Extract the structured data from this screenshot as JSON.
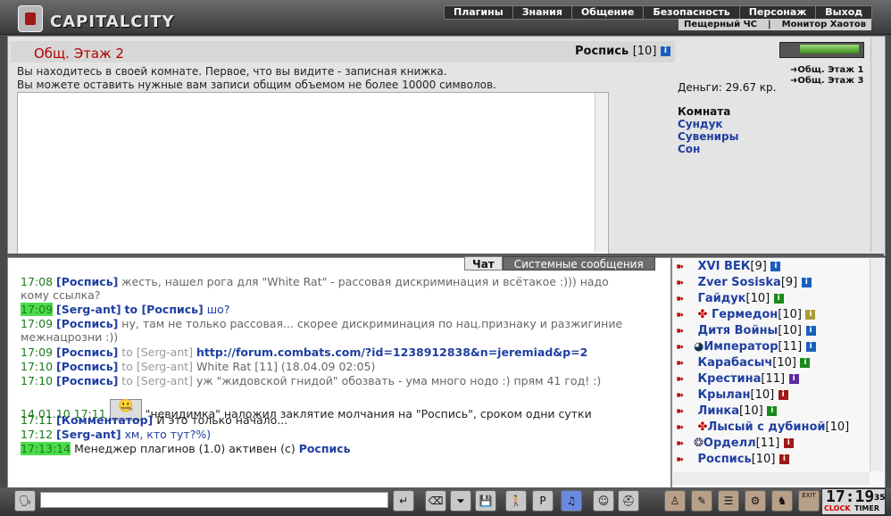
{
  "header": {
    "logo_text": "CAPITALCITY",
    "menu": [
      "Плагины",
      "Знания",
      "Общение",
      "Безопасность",
      "Персонаж",
      "Выход"
    ],
    "submenu": [
      "Пещерный ЧС",
      "|",
      "Монитор Хаотов"
    ]
  },
  "room": {
    "title": "Общ. Этаж 2",
    "user_name": "Роспись",
    "user_level": "[10]",
    "desc_line1": "Вы находитесь в своей комнате. Первое, что вы видите - записная книжка.",
    "desc_line2": "Вы можете оставить нужные вам записи общим объемом не более 10000 символов."
  },
  "side": {
    "nav1": "Общ. Этаж 1",
    "nav2": "Общ. Этаж 3",
    "money": "Деньги: 29.67 кр.",
    "room_heading": "Комната",
    "room_links": [
      "Сундук",
      "Сувениры",
      "Сон"
    ]
  },
  "chat_tabs": {
    "chat": "Чат",
    "system": "Системные сообщения"
  },
  "chat": [
    {
      "time": "17:08",
      "nick": "[Роспись]",
      "text": "жесть, нашел рога для \"White Rat\" - рассовая дискриминация и всётакое :))) надо"
    },
    {
      "cont": "кому ссылка?"
    },
    {
      "time": "17:09",
      "nick": "[Serg-ant]",
      "to": "to [Роспись]",
      "text": "шо?"
    },
    {
      "time": "17:09",
      "nick": "[Роспись]",
      "text": "ну, там не только рассовая... скорее дискриминация по нац.признаку и разжигиние"
    },
    {
      "cont": "межнацрозни :))"
    },
    {
      "time": "17:09",
      "nick": "[Роспись]",
      "to": "to [Serg-ant]",
      "url": "http://forum.combats.com/?id=1238912838&n=jeremiad&p=2"
    },
    {
      "time": "17:10",
      "nick": "[Роспись]",
      "to": "to [Serg-ant]",
      "text": "White Rat [11] (18.04.09 02:05)"
    },
    {
      "time": "17:10",
      "nick": "[Роспись]",
      "to": "to [Serg-ant]",
      "text": "уж \"жидовской гнидой\" обозвать - ума много нодо :) прям 41 год! :)"
    },
    {
      "time": "14.01.10 17:11",
      "text": "\"невидимка\" наложил заклятие молчания на \"Роспись\", сроком одни сутки"
    },
    {
      "time": "17:11",
      "nick": "[Комментатор]",
      "text": "И это только начало..."
    },
    {
      "time": "17:12",
      "nick": "[Serg-ant]",
      "text": "хм, кто тут?%)"
    },
    {
      "time": "17:13:14",
      "text": "Менеджер плагинов (1.0) активен (с)",
      "nick_end": "Роспись"
    }
  ],
  "users": [
    {
      "name": "XVI ВЕК",
      "level": "[9]"
    },
    {
      "name": "Zver Sosiska",
      "level": "[9]"
    },
    {
      "name": "Гайдук",
      "level": "[10]"
    },
    {
      "name": "Гермедон",
      "level": "[10]"
    },
    {
      "name": "Дитя Войны",
      "level": "[10]"
    },
    {
      "name": "Император",
      "level": "[11]"
    },
    {
      "name": "Карабасыч",
      "level": "[10]"
    },
    {
      "name": "Крестина",
      "level": "[11]"
    },
    {
      "name": "Крылан",
      "level": "[10]"
    },
    {
      "name": "Линка",
      "level": "[10]"
    },
    {
      "name": "Лысый с дубиной",
      "level": "[10]"
    },
    {
      "name": "Орделл",
      "level": "[11]"
    },
    {
      "name": "Роспись",
      "level": "[10]"
    }
  ],
  "clock": {
    "time": "17:19",
    "seconds": "35",
    "clock_label": "CLOCK",
    "timer_label": "TIMER"
  },
  "bottom": {
    "exit_label": "EXIT"
  }
}
